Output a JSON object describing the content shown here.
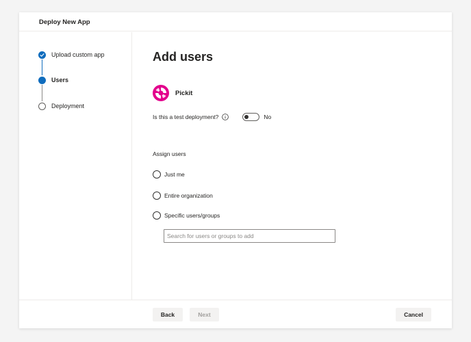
{
  "header": {
    "title": "Deploy New App"
  },
  "steps": [
    {
      "label": "Upload custom app",
      "state": "done"
    },
    {
      "label": "Users",
      "state": "current"
    },
    {
      "label": "Deployment",
      "state": "pending"
    }
  ],
  "main": {
    "title": "Add users",
    "app_name": "Pickit",
    "test_deployment_label": "Is this a test deployment?",
    "test_deployment_value": "No",
    "assign_label": "Assign users",
    "options": [
      "Just me",
      "Entire organization",
      "Specific users/groups"
    ],
    "search_placeholder": "Search for users or groups to add"
  },
  "footer": {
    "back_label": "Back",
    "next_label": "Next",
    "cancel_label": "Cancel"
  },
  "colors": {
    "accent": "#0f6cbd",
    "logo": "#e3008c"
  },
  "icons": {
    "done": "checkmark-icon",
    "info": "info-icon",
    "logo": "pickit-logo-icon"
  }
}
